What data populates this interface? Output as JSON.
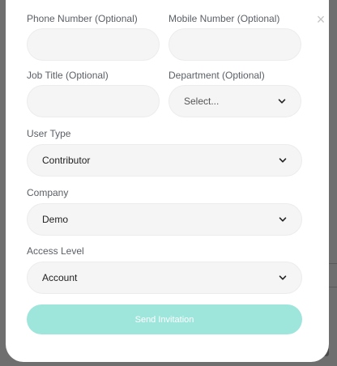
{
  "modal": {
    "close_icon": "close-icon",
    "fields": {
      "phone": {
        "label": "Phone Number (Optional)",
        "value": ""
      },
      "mobile": {
        "label": "Mobile Number (Optional)",
        "value": ""
      },
      "job_title": {
        "label": "Job Title (Optional)",
        "value": ""
      },
      "department": {
        "label": "Department (Optional)",
        "value": "Select..."
      },
      "user_type": {
        "label": "User Type",
        "value": "Contributor"
      },
      "company": {
        "label": "Company",
        "value": "Demo"
      },
      "access_level": {
        "label": "Access Level",
        "value": "Account"
      }
    },
    "submit_label": "Send Invitation"
  },
  "colors": {
    "overlay": "#6f6f6f",
    "field_bg": "#f5f5f5",
    "button_bg": "#9ee5db",
    "button_text": "#ffffff"
  }
}
